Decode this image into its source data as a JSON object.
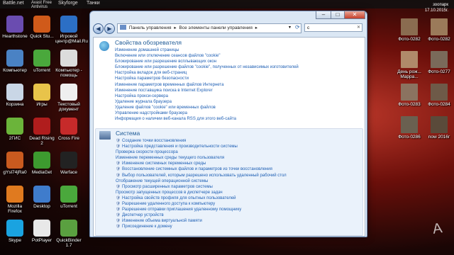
{
  "desktop": {
    "top_labels": [
      "Battle.net",
      "Avast Free Antivirus",
      "Skyforge",
      "Танки",
      "зоопарк"
    ],
    "clock": {
      "date_line1": "зоопарк",
      "date_line2": "17.10.2015г."
    },
    "left_icons": [
      {
        "label": "Hearthstone",
        "color": "#6a4cb0"
      },
      {
        "label": "Quick Stu...",
        "color": "#d05a1a"
      },
      {
        "label": "Игровой центр@Mail.Ru",
        "color": "#2c6fc5"
      },
      {
        "label": "Компьютер",
        "color": "#4a82c4"
      },
      {
        "label": "uTorrent",
        "color": "#4aa83c"
      },
      {
        "label": "Компьютер - помощь",
        "color": "#dcdcdc"
      },
      {
        "label": "Корзина",
        "color": "#c9d6e6"
      },
      {
        "label": "Игры",
        "color": "#e8c34a"
      },
      {
        "label": "Текстовый документ",
        "color": "#efefef"
      },
      {
        "label": "2ГИС",
        "color": "#6bb43a"
      },
      {
        "label": "Dead Rising 2",
        "color": "#b01d1d"
      },
      {
        "label": "Cross Fire",
        "color": "#c62a2a"
      },
      {
        "label": "gYsl74jRa0",
        "color": "#c95a1f"
      },
      {
        "label": "MediaGet",
        "color": "#3d9a2f"
      },
      {
        "label": "Warface",
        "color": "#222222"
      },
      {
        "label": "Mozilla Firefox",
        "color": "#e07a1f"
      },
      {
        "label": "Desktop",
        "color": "#3f7ccc"
      },
      {
        "label": "uTorrent",
        "color": "#4aa83c"
      },
      {
        "label": "Skype",
        "color": "#1aa3e0"
      },
      {
        "label": "PotPlayer",
        "color": "#e8e8e8"
      },
      {
        "label": "QuickBinder 1.7",
        "color": "#5aa040"
      }
    ],
    "right_icons": [
      {
        "label": "Фото-0282",
        "color": "#8a6c50"
      },
      {
        "label": "Фото-0282",
        "color": "#9b7a5a"
      },
      {
        "label": "День рож... Марра...",
        "color": "#b08a6a"
      },
      {
        "label": "Фото-0277",
        "color": "#7a6a5a"
      },
      {
        "label": "Фото-0283",
        "color": "#8b7360"
      },
      {
        "label": "Фото-0284",
        "color": "#6e5a48"
      },
      {
        "label": "Фото-0286",
        "color": "#6a6050"
      },
      {
        "label": "now 2016г",
        "color": "#5a4a3a"
      }
    ],
    "watermark": "A"
  },
  "window": {
    "controls": {
      "minimize": "–",
      "maximize": "□",
      "close": "✕"
    },
    "nav": {
      "back": "◀",
      "forward": "▶"
    },
    "breadcrumb": [
      "Панель управления",
      "▸",
      "Все элементы панели управления",
      "▸"
    ],
    "search_value": "с",
    "groups": [
      {
        "title": "Свойства обозревателя",
        "links": [
          {
            "text": "Изменение домашней страницы",
            "shield": false
          },
          {
            "text": "Включение или отключение сеансов файлов \"cookie\"",
            "shield": false
          },
          {
            "text": "Блокирование или разрешение всплывающих окон",
            "shield": false
          },
          {
            "text": "Блокирование или разрешение файлов \"cookie\", полученных от независимых изготовителей",
            "shield": false
          },
          {
            "text": "Настройка вкладок для веб-страниц",
            "shield": false
          },
          {
            "text": "Настройка параметров безопасности",
            "shield": false
          },
          {
            "text": "Изменение параметров временных файлов Интернета",
            "shield": false
          },
          {
            "text": "Изменение поставщика поиска в Internet Explorer",
            "shield": false
          },
          {
            "text": "Настройка прокси-сервера",
            "shield": false
          },
          {
            "text": "Удаление журнала браузера",
            "shield": false
          },
          {
            "text": "Удаление файлов \"cookie\" или временных файлов",
            "shield": false
          },
          {
            "text": "Управление надстройками браузера",
            "shield": false
          },
          {
            "text": "Информация о наличии веб-канала RSS для этого веб-сайта",
            "shield": false
          }
        ]
      },
      {
        "title": "Система",
        "links": [
          {
            "text": "Создание точки восстановления",
            "shield": true
          },
          {
            "text": "Настройка представления и производительности системы",
            "shield": true
          },
          {
            "text": "Проверка скорости процессора",
            "shield": false
          },
          {
            "text": "Изменение переменных среды текущего пользователя",
            "shield": false
          },
          {
            "text": "Изменение системных переменных среды",
            "shield": true
          },
          {
            "text": "Восстановление системных файлов и параметров из точки восстановления",
            "shield": true
          },
          {
            "text": "Выбор пользователей, которым разрешено использовать удаленный рабочий стол",
            "shield": true
          },
          {
            "text": "Отображение текущей операционной системы",
            "shield": false
          },
          {
            "text": "Просмотр расширенных параметров системы",
            "shield": true
          },
          {
            "text": "Просмотр запущенных процессов в диспетчере задач",
            "shield": false
          },
          {
            "text": "Настройка свойств профиля для опытных пользователей",
            "shield": true
          },
          {
            "text": "Разрешение удаленного доступа к компьютеру",
            "shield": true
          },
          {
            "text": "Разрешение отправки приглашения удаленному помощнику",
            "shield": true
          },
          {
            "text": "Диспетчер устройств",
            "shield": true
          },
          {
            "text": "Изменение объема виртуальной памяти",
            "shield": true
          },
          {
            "text": "Присоединение к домену",
            "shield": true
          }
        ]
      }
    ]
  }
}
